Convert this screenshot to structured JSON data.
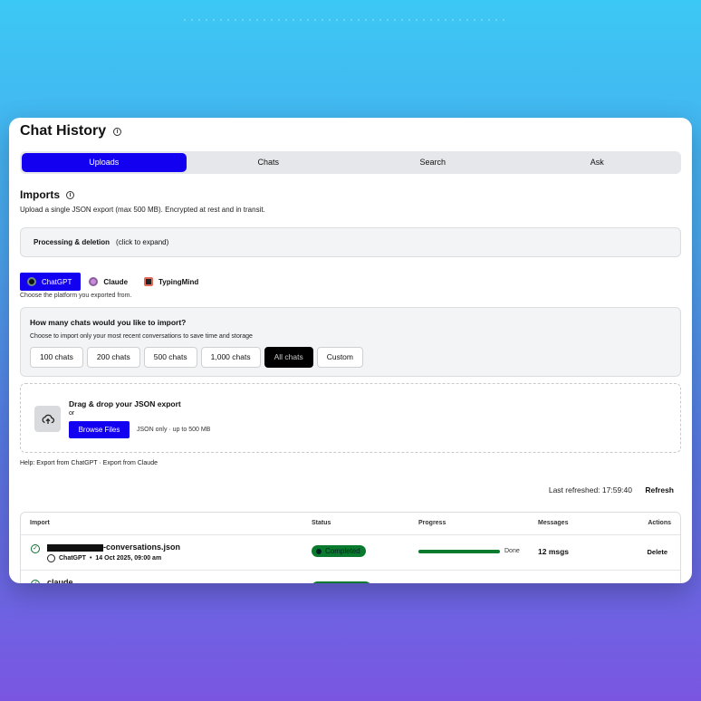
{
  "header": {
    "title": "Chat History"
  },
  "tabs": [
    {
      "label": "Uploads",
      "active": true
    },
    {
      "label": "Chats",
      "active": false
    },
    {
      "label": "Search",
      "active": false
    },
    {
      "label": "Ask",
      "active": false
    }
  ],
  "imports": {
    "title": "Imports",
    "subtitle": "Upload a single JSON export (max 500 MB). Encrypted at rest and in transit.",
    "expand_title": "Processing & deletion",
    "expand_hint": "(click to expand)"
  },
  "platforms": {
    "items": [
      {
        "label": "ChatGPT",
        "icon": "chatgpt-icon",
        "active": true
      },
      {
        "label": "Claude",
        "icon": "claude-icon",
        "active": false
      },
      {
        "label": "TypingMind",
        "icon": "typingmind-icon",
        "active": false
      }
    ],
    "hint": "Choose the platform you exported from."
  },
  "howmany": {
    "question": "How many chats would you like to import?",
    "description": "Choose to import only your most recent conversations to save time and storage",
    "options": [
      "100 chats",
      "200 chats",
      "500 chats",
      "1,000 chats",
      "All chats",
      "Custom"
    ],
    "selected": "All chats"
  },
  "dropzone": {
    "title": "Drag & drop your JSON export",
    "or": "or",
    "browse": "Browse Files",
    "limit": "JSON only · up to 500 MB"
  },
  "help": "Help: Export from ChatGPT · Export from Claude",
  "refresh": {
    "last": "Last refreshed: 17:59:40",
    "button": "Refresh"
  },
  "table": {
    "headers": [
      "Import",
      "Status",
      "Progress",
      "Messages",
      "Actions"
    ],
    "rows": [
      {
        "file_suffix": "-conversations.json",
        "platform": "ChatGPT",
        "date": "14 Oct 2025, 09:00 am",
        "status": "Completed",
        "progress": 1.0,
        "progress_label": "Done",
        "messages": "12 msgs",
        "action": "Delete"
      },
      {
        "file_suffix": "claude"
      }
    ]
  },
  "colors": {
    "accent": "#1400f0",
    "success": "#0a7a2e"
  }
}
